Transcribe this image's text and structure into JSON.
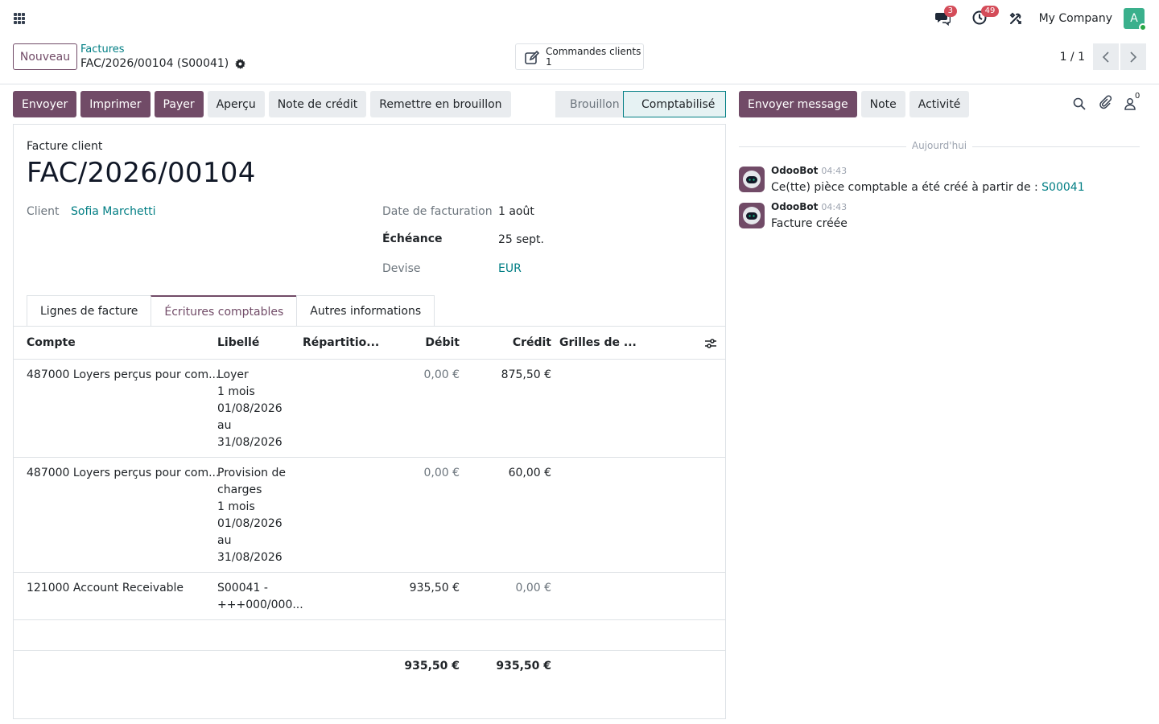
{
  "navbar": {
    "company": "My Company",
    "avatar_letter": "A",
    "discuss_badge": "3",
    "activity_badge": "49"
  },
  "control": {
    "new_button": "Nouveau",
    "breadcrumb_parent": "Factures",
    "breadcrumb_current": "FAC/2026/00104 (S00041)",
    "smart_button_label": "Commandes clients",
    "smart_button_count": "1",
    "pager": "1 / 1"
  },
  "actions": {
    "send": "Envoyer",
    "print": "Imprimer",
    "pay": "Payer",
    "preview": "Aperçu",
    "credit_note": "Note de crédit",
    "reset_draft": "Remettre en brouillon"
  },
  "status": {
    "draft": "Brouillon",
    "posted": "Comptabilisé"
  },
  "form": {
    "doc_type": "Facture client",
    "name": "FAC/2026/00104",
    "client_label": "Client",
    "client_value": "Sofia Marchetti",
    "invoice_date_label": "Date de facturation",
    "invoice_date_value": "1 août",
    "due_label": "Échéance",
    "due_value": "25 sept.",
    "currency_label": "Devise",
    "currency_value": "EUR"
  },
  "tabs": {
    "lines": "Lignes de facture",
    "entries": "Écritures comptables",
    "other": "Autres informations"
  },
  "table": {
    "headers": {
      "account": "Compte",
      "label": "Libellé",
      "distribution": "Répartitio...",
      "debit": "Débit",
      "credit": "Crédit",
      "tax_grids": "Grilles de ..."
    },
    "rows": [
      {
        "account": "487000 Loyers perçus pour com...",
        "label": [
          "Loyer",
          "1 mois",
          "01/08/2026",
          "au",
          "31/08/2026"
        ],
        "debit": "0,00 €",
        "credit": "875,50 €"
      },
      {
        "account": "487000 Loyers perçus pour com...",
        "label": [
          "Provision de",
          "charges",
          "1 mois",
          "01/08/2026",
          "au",
          "31/08/2026"
        ],
        "debit": "0,00 €",
        "credit": "60,00 €"
      },
      {
        "account": "121000 Account Receivable",
        "label": [
          "S00041 -",
          "+++000/000..."
        ],
        "debit": "935,50 €",
        "credit": "0,00 €"
      }
    ],
    "total_debit": "935,50 €",
    "total_credit": "935,50 €"
  },
  "chatter": {
    "send_message": "Envoyer message",
    "note": "Note",
    "activity": "Activité",
    "followers_count": "0",
    "date_separator": "Aujourd'hui",
    "messages": [
      {
        "author": "OdooBot",
        "time": "04:43",
        "text": "Ce(tte) pièce comptable a été créé à partir de : ",
        "link": "S00041"
      },
      {
        "author": "OdooBot",
        "time": "04:43",
        "text": "Facture créée"
      }
    ]
  },
  "colors": {
    "primary": "#714b67",
    "link": "#017e84",
    "badge": "#d44c59",
    "avatar": "#3ab08c"
  }
}
